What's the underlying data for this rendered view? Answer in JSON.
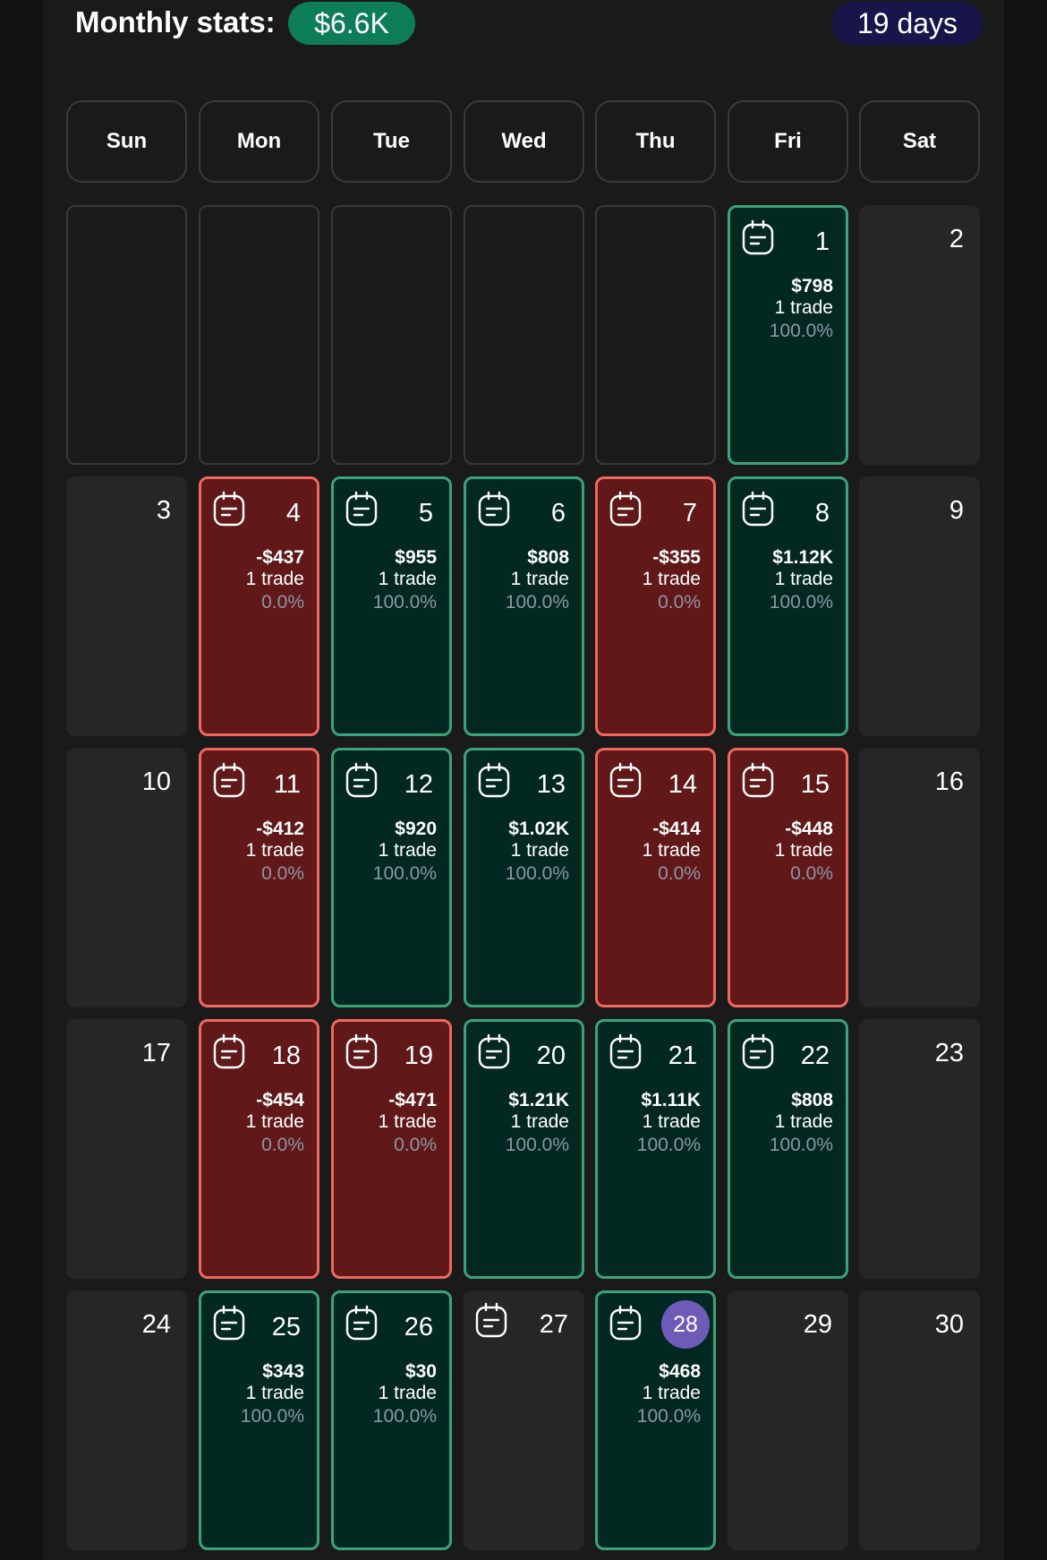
{
  "header": {
    "title": "Monthly stats:",
    "total": "$6.6K",
    "days": "19 days"
  },
  "colors": {
    "win_bg": "#032822",
    "win_border": "#3aa37a",
    "loss_bg": "#611819",
    "loss_border": "#f0675f",
    "total_pill": "#0d7d59",
    "days_pill": "#17154a",
    "today": "#6e5bb8"
  },
  "weekdays": [
    "Sun",
    "Mon",
    "Tue",
    "Wed",
    "Thu",
    "Fri",
    "Sat"
  ],
  "weeks": [
    [
      {
        "type": "empty"
      },
      {
        "type": "empty"
      },
      {
        "type": "empty"
      },
      {
        "type": "empty"
      },
      {
        "type": "empty"
      },
      {
        "type": "win",
        "day": "1",
        "amount": "$798",
        "trades": "1 trade",
        "pct": "100.0%",
        "icon": "notes-icon"
      },
      {
        "type": "none",
        "day": "2"
      }
    ],
    [
      {
        "type": "none",
        "day": "3"
      },
      {
        "type": "loss",
        "day": "4",
        "amount": "-$437",
        "trades": "1 trade",
        "pct": "0.0%",
        "icon": "notes-icon"
      },
      {
        "type": "win",
        "day": "5",
        "amount": "$955",
        "trades": "1 trade",
        "pct": "100.0%",
        "icon": "notes-icon"
      },
      {
        "type": "win",
        "day": "6",
        "amount": "$808",
        "trades": "1 trade",
        "pct": "100.0%",
        "icon": "notes-icon"
      },
      {
        "type": "loss",
        "day": "7",
        "amount": "-$355",
        "trades": "1 trade",
        "pct": "0.0%",
        "icon": "notes-icon"
      },
      {
        "type": "win",
        "day": "8",
        "amount": "$1.12K",
        "trades": "1 trade",
        "pct": "100.0%",
        "icon": "notes-icon"
      },
      {
        "type": "none",
        "day": "9"
      }
    ],
    [
      {
        "type": "none",
        "day": "10"
      },
      {
        "type": "loss",
        "day": "11",
        "amount": "-$412",
        "trades": "1 trade",
        "pct": "0.0%",
        "icon": "notes-icon"
      },
      {
        "type": "win",
        "day": "12",
        "amount": "$920",
        "trades": "1 trade",
        "pct": "100.0%",
        "icon": "notes-icon"
      },
      {
        "type": "win",
        "day": "13",
        "amount": "$1.02K",
        "trades": "1 trade",
        "pct": "100.0%",
        "icon": "notes-icon"
      },
      {
        "type": "loss",
        "day": "14",
        "amount": "-$414",
        "trades": "1 trade",
        "pct": "0.0%",
        "icon": "notes-icon"
      },
      {
        "type": "loss",
        "day": "15",
        "amount": "-$448",
        "trades": "1 trade",
        "pct": "0.0%",
        "icon": "notes-icon"
      },
      {
        "type": "none",
        "day": "16"
      }
    ],
    [
      {
        "type": "none",
        "day": "17"
      },
      {
        "type": "loss",
        "day": "18",
        "amount": "-$454",
        "trades": "1 trade",
        "pct": "0.0%",
        "icon": "notes-icon"
      },
      {
        "type": "loss",
        "day": "19",
        "amount": "-$471",
        "trades": "1 trade",
        "pct": "0.0%",
        "icon": "notes-icon"
      },
      {
        "type": "win",
        "day": "20",
        "amount": "$1.21K",
        "trades": "1 trade",
        "pct": "100.0%",
        "icon": "notes-icon"
      },
      {
        "type": "win",
        "day": "21",
        "amount": "$1.11K",
        "trades": "1 trade",
        "pct": "100.0%",
        "icon": "notes-icon"
      },
      {
        "type": "win",
        "day": "22",
        "amount": "$808",
        "trades": "1 trade",
        "pct": "100.0%",
        "icon": "notes-icon"
      },
      {
        "type": "none",
        "day": "23"
      }
    ],
    [
      {
        "type": "none",
        "day": "24"
      },
      {
        "type": "win",
        "day": "25",
        "amount": "$343",
        "trades": "1 trade",
        "pct": "100.0%",
        "icon": "notes-icon"
      },
      {
        "type": "win",
        "day": "26",
        "amount": "$30",
        "trades": "1 trade",
        "pct": "100.0%",
        "icon": "notes-icon"
      },
      {
        "type": "plain",
        "day": "27",
        "icon": "notes-icon"
      },
      {
        "type": "win",
        "day": "28",
        "today": true,
        "amount": "$468",
        "trades": "1 trade",
        "pct": "100.0%",
        "icon": "notes-icon"
      },
      {
        "type": "none",
        "day": "29"
      },
      {
        "type": "none",
        "day": "30"
      }
    ]
  ]
}
